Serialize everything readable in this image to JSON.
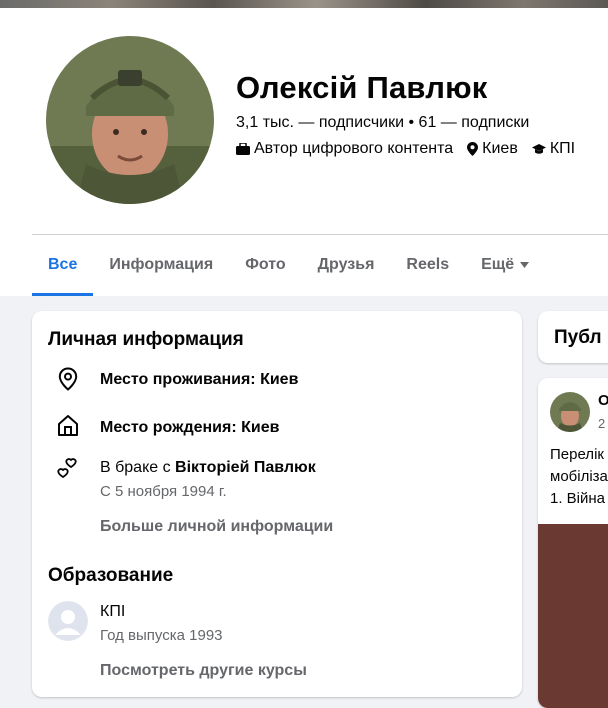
{
  "profile": {
    "name": "Олексій Павлюк",
    "followers": "3,1 тыс. — подписчики",
    "separator": "•",
    "following": "61 — подписки",
    "role": "Автор цифрового контента",
    "city": "Киев",
    "school": "КПІ"
  },
  "tabs": [
    {
      "label": "Все",
      "active": true
    },
    {
      "label": "Информация"
    },
    {
      "label": "Фото"
    },
    {
      "label": "Друзья"
    },
    {
      "label": "Reels"
    },
    {
      "label": "Ещё"
    }
  ],
  "intro": {
    "title": "Личная информация",
    "residence_label": "Место проживания: ",
    "residence_value": "Киев",
    "birthplace_label": "Место рождения: ",
    "birthplace_value": "Киев",
    "relationship_prefix": "В браке с ",
    "relationship_partner": "Вікторіей Павлюк",
    "relationship_since": "С 5 ноября 1994 г.",
    "more_link": "Больше личной информации"
  },
  "education": {
    "title": "Образование",
    "school": "КПІ",
    "class_of": "Год выпуска 1993",
    "more_link": "Посмотреть другие курсы"
  },
  "posts": {
    "header": "Публ",
    "author_initial": "О",
    "date_partial": "2",
    "text_lines": [
      "Перелік",
      "мобіліза",
      "1. Війна"
    ]
  },
  "colors": {
    "accent": "#1b74e4",
    "secondary_text": "#65676b",
    "background": "#f0f2f5"
  }
}
